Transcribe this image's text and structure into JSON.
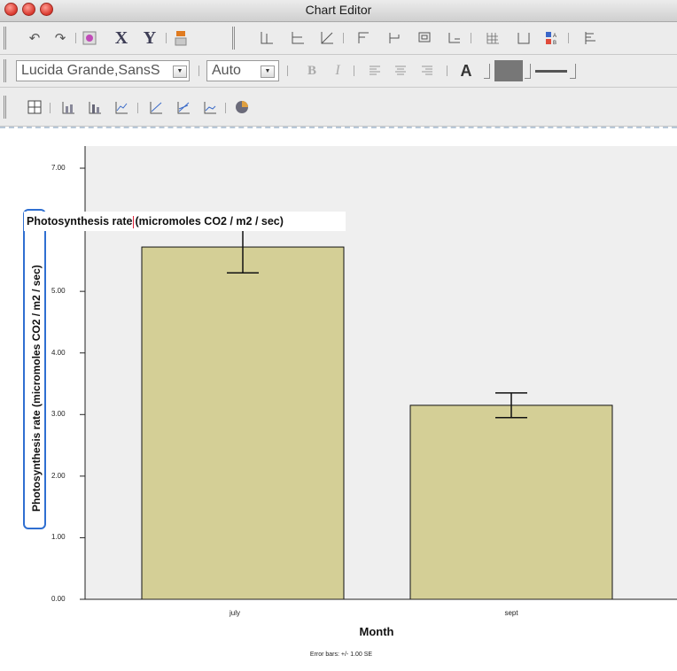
{
  "window": {
    "title": "Chart Editor"
  },
  "toolbar1": {
    "icons": [
      "undo-icon",
      "redo-icon",
      "properties-icon",
      "x-axis-icon",
      "y-axis-icon",
      "transpose-icon",
      "bar-chart-icon",
      "line-axis-icon",
      "diagonal-axis-icon",
      "data-label-icon",
      "text-box-icon",
      "annotation-icon",
      "footnote-icon",
      "grid-icon",
      "frame-icon",
      "legend-icon",
      "align-icon"
    ],
    "x_label": "X",
    "y_label": "Y"
  },
  "toolbar2": {
    "font_family": "Lucida Grande,SansS",
    "font_size": "Auto",
    "bold_label": "B",
    "italic_label": "I",
    "font_color_label": "A"
  },
  "chart_data": {
    "type": "bar",
    "categories": [
      "july",
      "sept"
    ],
    "values": [
      5.72,
      3.15
    ],
    "error_low": [
      5.3,
      2.95
    ],
    "error_high": [
      6.1,
      3.35
    ],
    "ylim": [
      0,
      7.5
    ],
    "ytick_labels": [
      "0.00",
      "1.00",
      "2.00",
      "3.00",
      "4.00",
      "5.00",
      "7.00"
    ],
    "xlabel": "Month",
    "ylabel": "Photosynthesis rate (micromoles CO2 / m2 / sec)",
    "footnote": "Error bars: +/- 1.00 SE",
    "bar_color": "#d4cf96",
    "plot_background": "#efefef"
  },
  "editor": {
    "edit_text": "Photosynthesis rate (micromoles CO2 / m2 / sec)",
    "edit_text_before_caret": "Photosynthesis rate",
    "edit_text_after_caret": "(micromoles CO2 / m2 / sec)"
  }
}
